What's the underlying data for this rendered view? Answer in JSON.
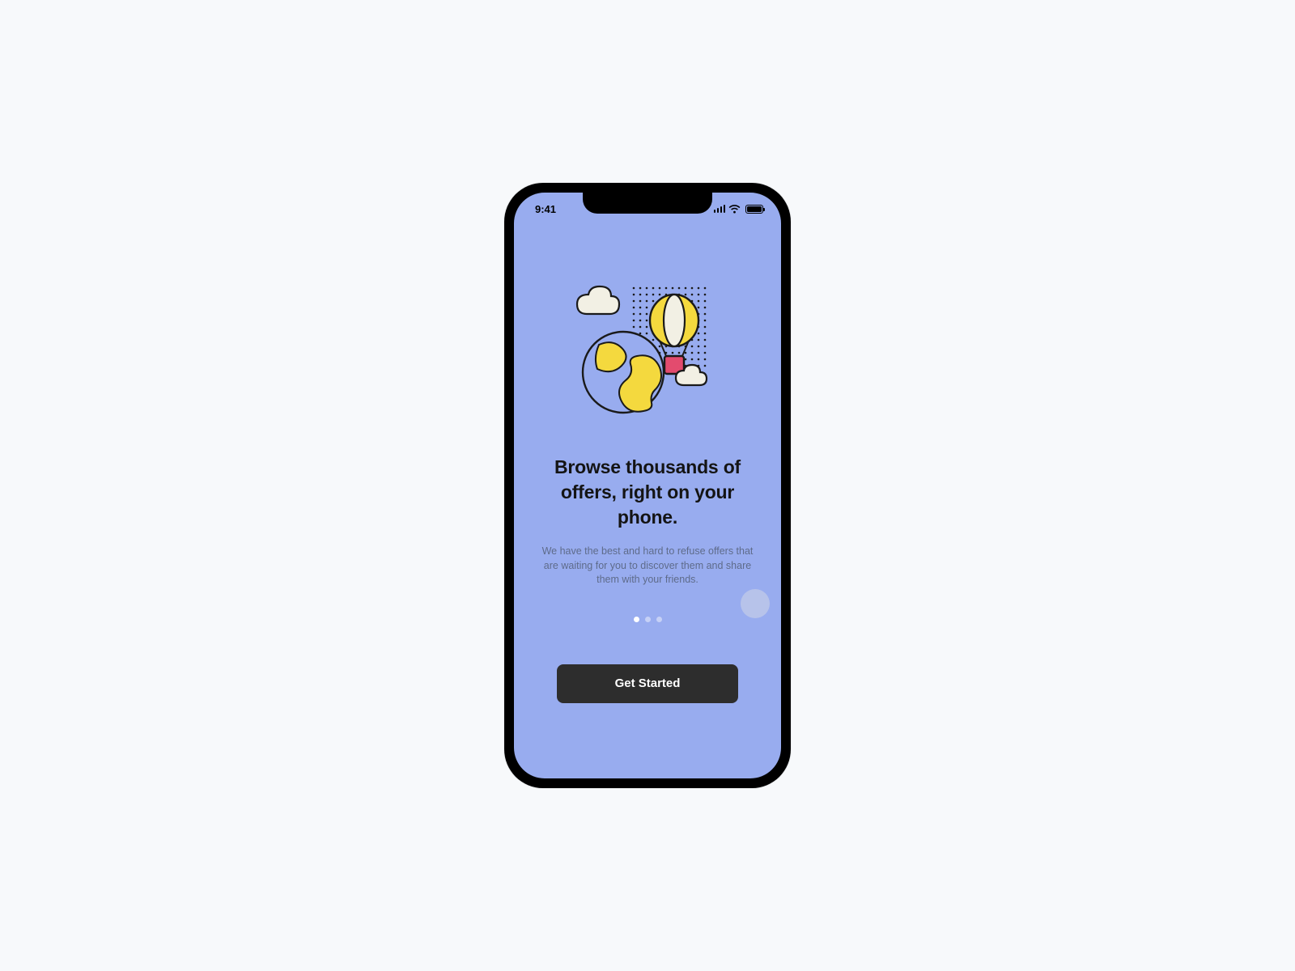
{
  "statusBar": {
    "time": "9:41",
    "signalIcon": "cellular-signal-icon",
    "wifiIcon": "wifi-icon",
    "batteryIcon": "battery-icon"
  },
  "onboarding": {
    "headline": "Browse thousands of offers, right  on your phone.",
    "subtext": "We have the best and hard to refuse offers that are waiting for you to discover them and share them with your friends.",
    "cta_label": "Get Started",
    "page_count": 3,
    "active_page_index": 0
  },
  "illustration": {
    "name": "globe-balloon-clouds-illustration",
    "elements": [
      "cloud",
      "dot-grid",
      "hot-air-balloon",
      "globe",
      "small-cloud"
    ]
  },
  "colors": {
    "screen_bg": "#98acef",
    "button_bg": "#2d2d2d",
    "headline": "#141414",
    "subtext": "#5e6b8a",
    "balloon_yellow": "#f4d93e",
    "balloon_basket": "#e34b6e",
    "cloud_fill": "#f2f0e4"
  }
}
